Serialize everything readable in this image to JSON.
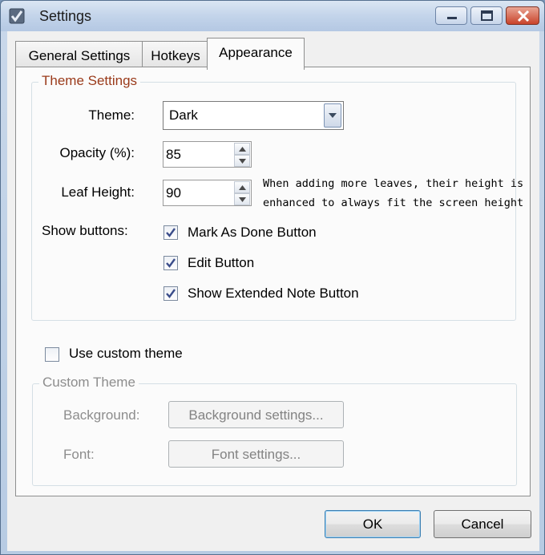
{
  "window": {
    "title": "Settings",
    "icon": "checkmark-app-icon",
    "controls": {
      "minimize": "minimize-icon",
      "maximize": "maximize-icon",
      "close": "close-icon"
    }
  },
  "tabs": [
    {
      "label": "General Settings",
      "selected": false
    },
    {
      "label": "Hotkeys",
      "selected": false
    },
    {
      "label": "Appearance",
      "selected": true
    }
  ],
  "theme_settings": {
    "legend": "Theme Settings",
    "theme": {
      "label": "Theme:",
      "value": "Dark"
    },
    "opacity": {
      "label": "Opacity (%):",
      "value": "85"
    },
    "leaf_height": {
      "label": "Leaf Height:",
      "value": "90",
      "note_line1": "When adding more leaves, their height is",
      "note_line2": "enhanced to always fit the screen height"
    },
    "show_buttons": {
      "label": "Show buttons:",
      "options": [
        {
          "label": "Mark As Done Button",
          "checked": true
        },
        {
          "label": "Edit Button",
          "checked": true
        },
        {
          "label": "Show Extended Note Button",
          "checked": true
        }
      ]
    }
  },
  "use_custom_theme": {
    "label": "Use custom theme",
    "checked": false
  },
  "custom_theme": {
    "legend": "Custom Theme",
    "background": {
      "label": "Background:",
      "button": "Background settings..."
    },
    "font": {
      "label": "Font:",
      "button": "Font settings..."
    }
  },
  "footer": {
    "ok": "OK",
    "cancel": "Cancel"
  },
  "colors": {
    "group_legend": "#9a3a1a",
    "disabled_text": "#8d8d8d",
    "checkmark": "#3a4c8a"
  }
}
